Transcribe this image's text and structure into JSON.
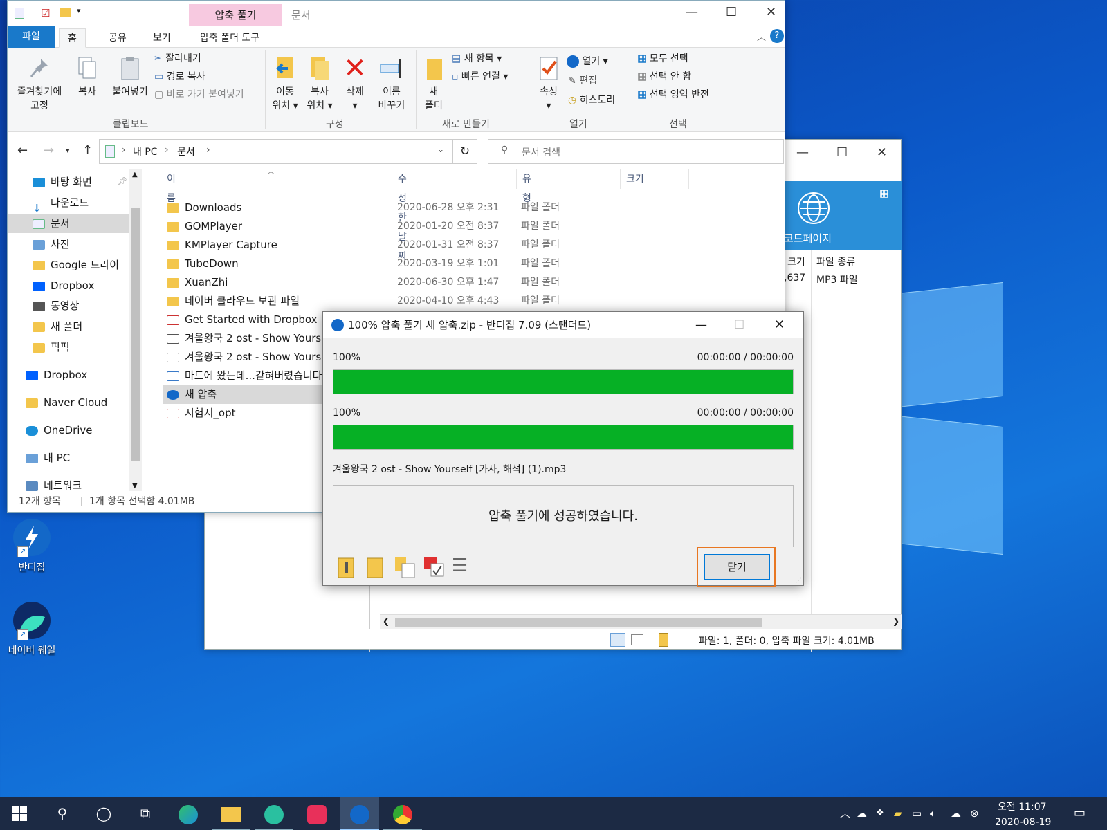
{
  "explorer": {
    "qat_tab": "압축 풀기",
    "window_title": "문서",
    "tabs": {
      "file": "파일",
      "home": "홈",
      "share": "공유",
      "view": "보기",
      "tools": "압축 폴더 도구"
    },
    "ribbon": {
      "pin": "즐겨찾기에",
      "pin2": "고정",
      "copy": "복사",
      "paste": "붙여넣기",
      "cut": "잘라내기",
      "copy_path": "경로 복사",
      "paste_shortcut": "바로 가기 붙여넣기",
      "move_to": "이동",
      "move_to2": "위치 ▾",
      "copy_to": "복사",
      "copy_to2": "위치 ▾",
      "delete": "삭제",
      "delete2": "▾",
      "rename": "이름",
      "rename2": "바꾸기",
      "new_folder": "새",
      "new_folder2": "폴더",
      "new_item": "새 항목 ▾",
      "easy_access": "빠른 연결 ▾",
      "properties": "속성",
      "properties2": "▾",
      "open": "열기 ▾",
      "edit": "편집",
      "history": "히스토리",
      "select_all": "모두 선택",
      "select_none": "선택 안 함",
      "invert": "선택 영역 반전",
      "groups": {
        "clipboard": "클립보드",
        "organize": "구성",
        "new": "새로 만들기",
        "open": "열기",
        "select": "선택"
      }
    },
    "address": {
      "pc": "내 PC",
      "folder": "문서",
      "search_placeholder": "문서 검색"
    },
    "nav": [
      {
        "label": "바탕 화면",
        "icon": "desktop-icon"
      },
      {
        "label": "다운로드",
        "icon": "download-icon"
      },
      {
        "label": "문서",
        "icon": "document-icon"
      },
      {
        "label": "사진",
        "icon": "picture-icon"
      },
      {
        "label": "Google 드라이",
        "icon": "folder-icon"
      },
      {
        "label": "Dropbox",
        "icon": "dropbox-icon"
      },
      {
        "label": "동영상",
        "icon": "video-icon"
      },
      {
        "label": "새 폴더",
        "icon": "folder-icon"
      },
      {
        "label": "픽픽",
        "icon": "folder-icon"
      },
      {
        "label": "Dropbox",
        "icon": "dropbox-icon"
      },
      {
        "label": "Naver Cloud",
        "icon": "folder-icon"
      },
      {
        "label": "OneDrive",
        "icon": "cloud-icon"
      },
      {
        "label": "내 PC",
        "icon": "pc-icon"
      },
      {
        "label": "네트워크",
        "icon": "network-icon"
      }
    ],
    "columns": {
      "name": "이름",
      "date": "수정한 날짜",
      "type": "유형",
      "size": "크기"
    },
    "files": [
      {
        "name": "Downloads",
        "date": "2020-06-28 오후 2:31",
        "type": "파일 폴더",
        "icon": "folder-icon"
      },
      {
        "name": "GOMPlayer",
        "date": "2020-01-20 오전 8:37",
        "type": "파일 폴더",
        "icon": "folder-icon"
      },
      {
        "name": "KMPlayer Capture",
        "date": "2020-01-31 오전 8:37",
        "type": "파일 폴더",
        "icon": "folder-icon"
      },
      {
        "name": "TubeDown",
        "date": "2020-03-19 오후 1:01",
        "type": "파일 폴더",
        "icon": "folder-icon"
      },
      {
        "name": "XuanZhi",
        "date": "2020-06-30 오후 1:47",
        "type": "파일 폴더",
        "icon": "folder-icon"
      },
      {
        "name": "네이버 클라우드 보관 파일",
        "date": "2020-04-10 오후 4:43",
        "type": "파일 폴더",
        "icon": "folder-icon"
      },
      {
        "name": "Get Started with Dropbox",
        "date": "",
        "type": "",
        "icon": "pdf-icon"
      },
      {
        "name": "겨울왕국 2 ost - Show Yourself",
        "date": "",
        "type": "",
        "icon": "audio-icon"
      },
      {
        "name": "겨울왕국 2 ost - Show Yourself",
        "date": "",
        "type": "",
        "icon": "audio-icon"
      },
      {
        "name": "마트에 왔는데...갇혀버렸습니다",
        "date": "",
        "type": "",
        "icon": "file-icon"
      },
      {
        "name": "새 압축",
        "date": "",
        "type": "",
        "icon": "zip-icon"
      },
      {
        "name": "시험지_opt",
        "date": "",
        "type": "",
        "icon": "pdf-icon"
      }
    ],
    "status_count": "12개 항목",
    "status_selected": "1개 항목 선택함 4.01MB"
  },
  "bandizip": {
    "codepage": "코드페이지",
    "col_size": "크기",
    "col_type": "파일 종류",
    "size_val": ",637",
    "type_val": "MP3 파일",
    "status": "파일: 1, 폴더: 0, 압축 파일 크기: 4.01MB"
  },
  "dialog": {
    "title": "100% 압축 풀기 새 압축.zip - 반디집 7.09 (스탠더드)",
    "p1_pct": "100%",
    "p1_time": "00:00:00 / 00:00:00",
    "p1_value": 1.0,
    "p2_pct": "100%",
    "p2_time": "00:00:00 / 00:00:00",
    "p2_value": 1.0,
    "file": "겨울왕국 2 ost - Show Yourself [가사, 해석] (1).mp3",
    "message": "압축 풀기에 성공하였습니다.",
    "close": "닫기"
  },
  "desktop": {
    "bandizip": "반디집",
    "whale": "네이버 웨일"
  },
  "tray": {
    "time": "오전 11:07",
    "date": "2020-08-19"
  },
  "colors": {
    "progress": "#06b025",
    "accent": "#0078d7",
    "taskbar": "#1c2a44"
  }
}
